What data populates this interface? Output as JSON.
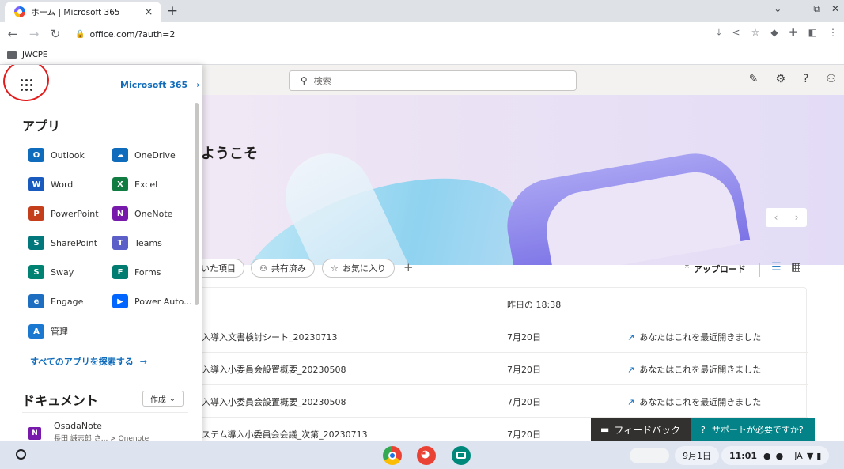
{
  "browser": {
    "tab_title": "ホーム | Microsoft 365",
    "tab_close": "×",
    "new_tab": "+",
    "window_controls": [
      "⌄",
      "—",
      "⧉",
      "✕"
    ],
    "url": "office.com/?auth=2",
    "bookmark": "JWCPE"
  },
  "header": {
    "search_placeholder": "検索",
    "icons": [
      "edit-note-icon",
      "settings-icon",
      "help-icon",
      "profile-icon"
    ]
  },
  "hero": {
    "title": "ようこそ"
  },
  "filters": {
    "recent_partial": "いた項目",
    "shared": "共有済み",
    "favorites": "お気に入り",
    "add": "+",
    "upload": "アップロード"
  },
  "files": [
    {
      "name": "",
      "date": "昨日の 18:38",
      "activity": ""
    },
    {
      "name": "入導入文書検討シート_20230713",
      "date": "7月20日",
      "activity": "あなたはこれを最近開きました"
    },
    {
      "name": "入導入小委員会設置概要_20230508",
      "date": "7月20日",
      "activity": "あなたはこれを最近開きました"
    },
    {
      "name": "入導入小委員会設置概要_20230508",
      "date": "7月20日",
      "activity": "あなたはこれを最近開きました"
    },
    {
      "name": "ステム導入小委員会会議_次第_20230713",
      "date": "7月20日",
      "activity": ""
    }
  ],
  "launcher": {
    "m365_link": "Microsoft 365",
    "apps_title": "アプリ",
    "apps": [
      {
        "label": "Outlook",
        "icon": "O",
        "color": "#0f6cbd"
      },
      {
        "label": "OneDrive",
        "icon": "☁",
        "color": "#0f6cbd"
      },
      {
        "label": "Word",
        "icon": "W",
        "color": "#185abd"
      },
      {
        "label": "Excel",
        "icon": "X",
        "color": "#107c41"
      },
      {
        "label": "PowerPoint",
        "icon": "P",
        "color": "#c43e1c"
      },
      {
        "label": "OneNote",
        "icon": "N",
        "color": "#7719aa"
      },
      {
        "label": "SharePoint",
        "icon": "S",
        "color": "#03787c"
      },
      {
        "label": "Teams",
        "icon": "T",
        "color": "#5b5fc7"
      },
      {
        "label": "Sway",
        "icon": "S",
        "color": "#008272"
      },
      {
        "label": "Forms",
        "icon": "F",
        "color": "#007c70"
      },
      {
        "label": "Engage",
        "icon": "e",
        "color": "#1d6ec0"
      },
      {
        "label": "Power Auto...",
        "icon": "▶",
        "color": "#0066ff"
      },
      {
        "label": "管理",
        "icon": "A",
        "color": "#1a78d0"
      }
    ],
    "explore": "すべてのアプリを探索する",
    "docs_title": "ドキュメント",
    "create": "作成",
    "doc": {
      "name": "OsadaNote",
      "path": "長田 謙志郎 さ... > Onenote",
      "icon": "N"
    }
  },
  "feedback": {
    "feedback_label": "フィードバック",
    "support_label": "サポートが必要ですか?"
  },
  "shelf": {
    "date": "9月1日",
    "time": "11:01",
    "ime": "JA"
  }
}
